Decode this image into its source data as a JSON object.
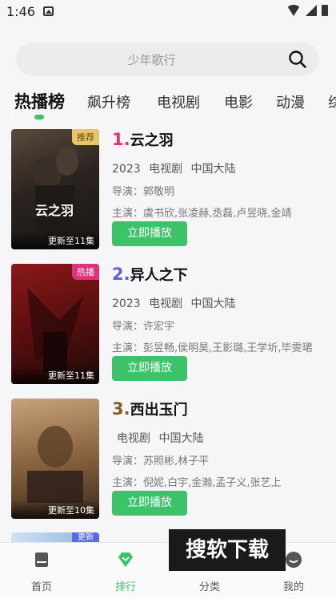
{
  "status_bar": {
    "time": "1:46"
  },
  "search": {
    "placeholder": "少年歌行"
  },
  "tabs": [
    {
      "label": "热播榜"
    },
    {
      "label": "飙升榜"
    },
    {
      "label": "电视剧"
    },
    {
      "label": "电影"
    },
    {
      "label": "动漫"
    },
    {
      "label": "综"
    }
  ],
  "items": [
    {
      "rank": "1.",
      "rank_color": "#e0317a",
      "name": "云之羽",
      "year": "2023",
      "genre": "电视剧",
      "region": "中国大陆",
      "director": "导演：郭敬明",
      "cast": "主演：虞书欣,张凌赫,丞磊,卢昱晓,金靖",
      "badge": "推荐",
      "badge_color": "#e8c46a",
      "update": "更新至11集",
      "poster_title": "云之羽",
      "play_label": "立即播放"
    },
    {
      "rank": "2.",
      "rank_color": "#5b5fe0",
      "name": "异人之下",
      "year": "2023",
      "genre": "电视剧",
      "region": "中国大陆",
      "director": "导演：许宏宇",
      "cast": "主演：彭昱畅,侯明昊,王影璐,王学圻,毕雯珺",
      "badge": "热播",
      "badge_color": "#e0317a",
      "update": "更新至11集",
      "poster_title": "",
      "play_label": "立即播放"
    },
    {
      "rank": "3.",
      "rank_color": "#8a5a2a",
      "name": "西出玉门",
      "year": "",
      "genre": "电视剧",
      "region": "中国大陆",
      "director": "导演：苏照彬,林子平",
      "cast": "主演：倪妮,白宇,金瀚,孟子义,张艺上",
      "badge": "",
      "badge_color": "",
      "update": "更新至10集",
      "poster_title": "",
      "play_label": "立即播放"
    }
  ],
  "partial_badge": "更新",
  "watermark": "搜软下载",
  "bottom_nav": [
    {
      "label": "首页"
    },
    {
      "label": "排行"
    },
    {
      "label": "分类"
    },
    {
      "label": "我的"
    }
  ]
}
